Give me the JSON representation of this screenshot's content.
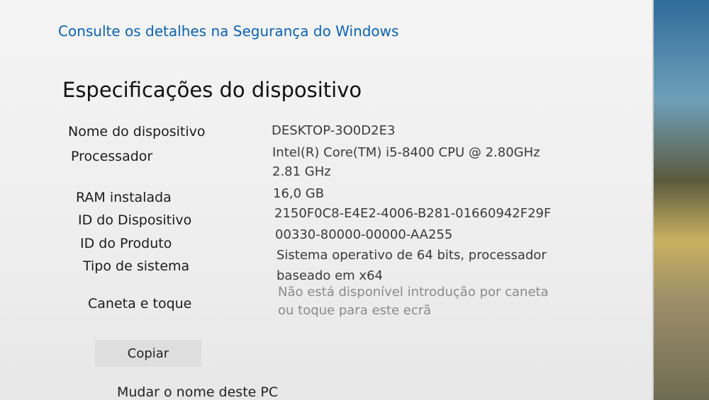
{
  "links": {
    "security_details": "Consulte os detalhes na Segurança do Windows"
  },
  "device_specs": {
    "title": "Especificações do dispositivo",
    "rows": [
      {
        "label": "Nome do dispositivo",
        "value_lines": [
          "DESKTOP-3O0D2E3"
        ]
      },
      {
        "label": "Processador",
        "value_lines": [
          "Intel(R) Core(TM) i5-8400 CPU @ 2.80GHz",
          "2.81 GHz"
        ]
      },
      {
        "label": "RAM instalada",
        "value_lines": [
          "16,0 GB"
        ]
      },
      {
        "label": "ID do Dispositivo",
        "value_lines": [
          "2150F0C8-E4E2-4006-B281-01660942F29F"
        ]
      },
      {
        "label": "ID do Produto",
        "value_lines": [
          "00330-80000-00000-AA255"
        ]
      },
      {
        "label": "Tipo de sistema",
        "value_lines": [
          "Sistema operativo de 64 bits, processador",
          "baseado em x64"
        ]
      },
      {
        "label": "Caneta e toque",
        "value_lines": [
          "Não está disponível introdução por caneta",
          "ou toque para este ecrã"
        ]
      }
    ],
    "copy_label": "Copiar",
    "rename_label": "Mudar o nome deste PC"
  }
}
